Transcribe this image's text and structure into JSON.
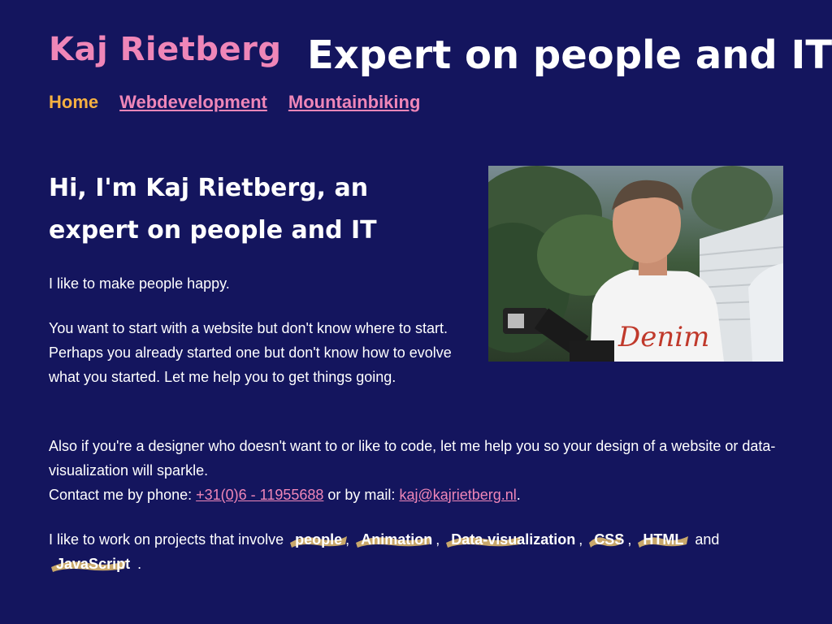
{
  "header": {
    "site_title": "Kaj Rietberg",
    "tagline": "Expert on people and IT"
  },
  "nav": {
    "items": [
      {
        "label": "Home"
      },
      {
        "label": "Webdevelopment"
      },
      {
        "label": "Mountainbiking"
      }
    ]
  },
  "main": {
    "heading": "Hi, I'm Kaj Rietberg, an expert on people and IT",
    "p1": "I like to make people happy.",
    "p2": "You want to start with a website but don't know where to start. Perhaps you already started one but don't know how to evolve what you started. Let me help you to get things going.",
    "p3": "Also if you're a designer who doesn't want to or like to code, let me help you so your design of a website or data-visualization will sparkle.",
    "contact": {
      "phone_prefix": "Contact me by phone: ",
      "phone": "+31(0)6 - 11955688",
      "mail_prefix": " or by mail: ",
      "mail": "kaj@kajrietberg.nl",
      "end": "."
    },
    "interests": {
      "prefix": "I like to work on projects that involve",
      "tags": [
        "people",
        "Animation",
        "Data-visualization",
        "CSS",
        "HTML",
        "JavaScript"
      ],
      "sep": ",",
      "and": "and",
      "end": "."
    }
  },
  "colors": {
    "background": "#14155e",
    "accent_pink": "#ef86b8",
    "active_nav": "#f5b041",
    "highlight": "#c9a86b"
  }
}
